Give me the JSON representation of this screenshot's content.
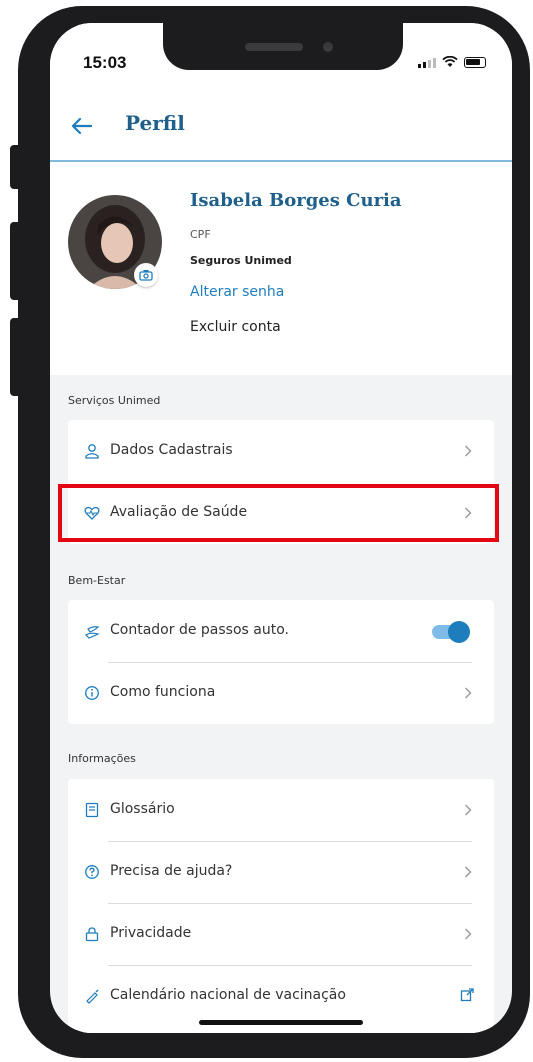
{
  "status_bar": {
    "time": "15:03"
  },
  "header": {
    "title": "Perfil"
  },
  "profile": {
    "name": "Isabela Borges Curia",
    "cpf_label": "CPF",
    "insurer": "Seguros Unimed",
    "change_password": "Alterar senha",
    "delete_account": "Excluir conta"
  },
  "sections": {
    "services": {
      "label": "Serviços Unimed",
      "items": [
        {
          "label": "Dados Cadastrais",
          "icon": "person-icon"
        },
        {
          "label": "Avaliação de Saúde",
          "icon": "heart-pulse-icon"
        }
      ]
    },
    "wellbeing": {
      "label": "Bem-Estar",
      "items": [
        {
          "label": "Contador de passos auto.",
          "icon": "footsteps-icon",
          "toggle_on": true
        },
        {
          "label": "Como funciona",
          "icon": "info-icon"
        }
      ]
    },
    "info": {
      "label": "Informações",
      "items": [
        {
          "label": "Glossário",
          "icon": "book-icon"
        },
        {
          "label": "Precisa de ajuda?",
          "icon": "help-icon"
        },
        {
          "label": "Privacidade",
          "icon": "lock-icon"
        },
        {
          "label": "Calendário nacional de vacinação",
          "icon": "syringe-icon"
        }
      ]
    }
  },
  "colors": {
    "brand_blue": "#1f5f8b",
    "link_blue": "#1e7ebd",
    "background": "#f1f3f4",
    "highlight_red": "#e30613"
  }
}
